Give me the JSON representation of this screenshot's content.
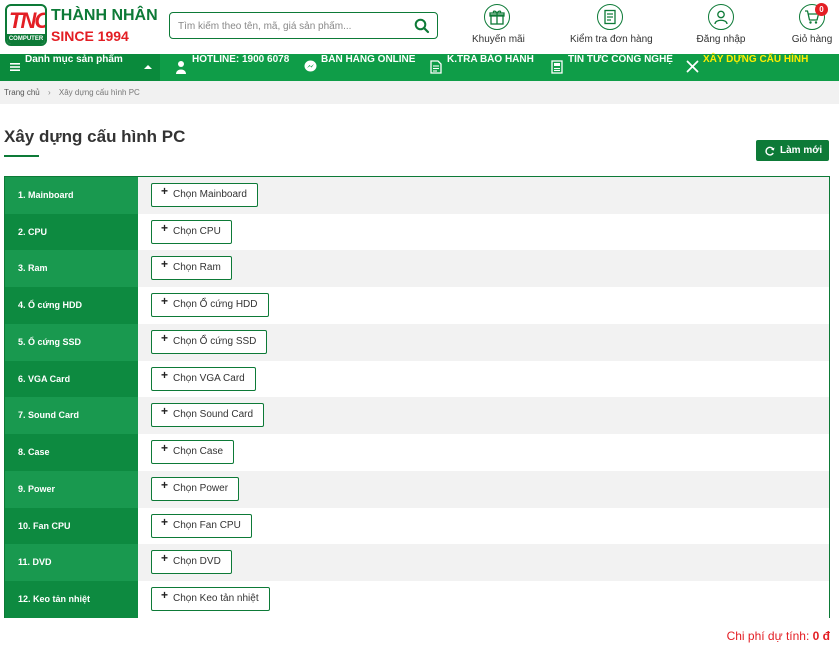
{
  "header": {
    "logo_mark": "TNC",
    "logo_mark_sub": "COMPUTER",
    "brand_name": "THÀNH NHÂN",
    "brand_since": "SINCE 1994",
    "search_placeholder": "Tìm kiếm theo tên, mã, giá sản phẩm...",
    "icons": [
      {
        "label": "Khuyến mãi",
        "icon": "gift-icon"
      },
      {
        "label": "Kiểm tra đơn hàng",
        "icon": "order-check-icon"
      },
      {
        "label": "Đăng nhập",
        "icon": "user-icon"
      },
      {
        "label": "Giỏ hàng",
        "icon": "cart-icon"
      }
    ],
    "cart_count": "0"
  },
  "nav": {
    "category_menu": "Danh mục sản phẩm",
    "hotline": "HOTLINE: 1900 6078",
    "online_sales": "BÁN HÀNG ONLINE",
    "warranty": "K.TRA BẢO HÀNH",
    "tech_news": "TIN TỨC CÔNG NGHỆ",
    "build_pc": "XÂY DỰNG CẤU HÌNH"
  },
  "breadcrumb": {
    "home": "Trang chủ",
    "separator": "›",
    "current": "Xây dựng cấu hình PC"
  },
  "page": {
    "title": "Xây dựng cấu hình PC",
    "refresh_label": "Làm mới"
  },
  "components": [
    {
      "label": "1. Mainboard",
      "button": "Chọn Mainboard"
    },
    {
      "label": "2. CPU",
      "button": "Chọn CPU"
    },
    {
      "label": "3. Ram",
      "button": "Chọn Ram"
    },
    {
      "label": "4. Ổ cứng HDD",
      "button": "Chọn Ổ cứng HDD"
    },
    {
      "label": "5. Ổ cứng SSD",
      "button": "Chọn Ổ cứng SSD"
    },
    {
      "label": "6. VGA Card",
      "button": "Chọn VGA Card"
    },
    {
      "label": "7. Sound Card",
      "button": "Chọn Sound Card"
    },
    {
      "label": "8. Case",
      "button": "Chọn Case"
    },
    {
      "label": "9. Power",
      "button": "Chọn Power"
    },
    {
      "label": "10. Fan CPU",
      "button": "Chọn Fan CPU"
    },
    {
      "label": "11. DVD",
      "button": "Chọn DVD"
    },
    {
      "label": "12. Keo tản nhiệt",
      "button": "Chọn Keo tản nhiệt"
    }
  ],
  "summary": {
    "cost_label": "Chi phí dự tính:",
    "cost_value": "0 đ"
  },
  "colors": {
    "brand_green": "#0d7a37",
    "nav_green": "#0f9d48",
    "accent_red": "#e31e24",
    "active_nav": "#ffee00"
  }
}
